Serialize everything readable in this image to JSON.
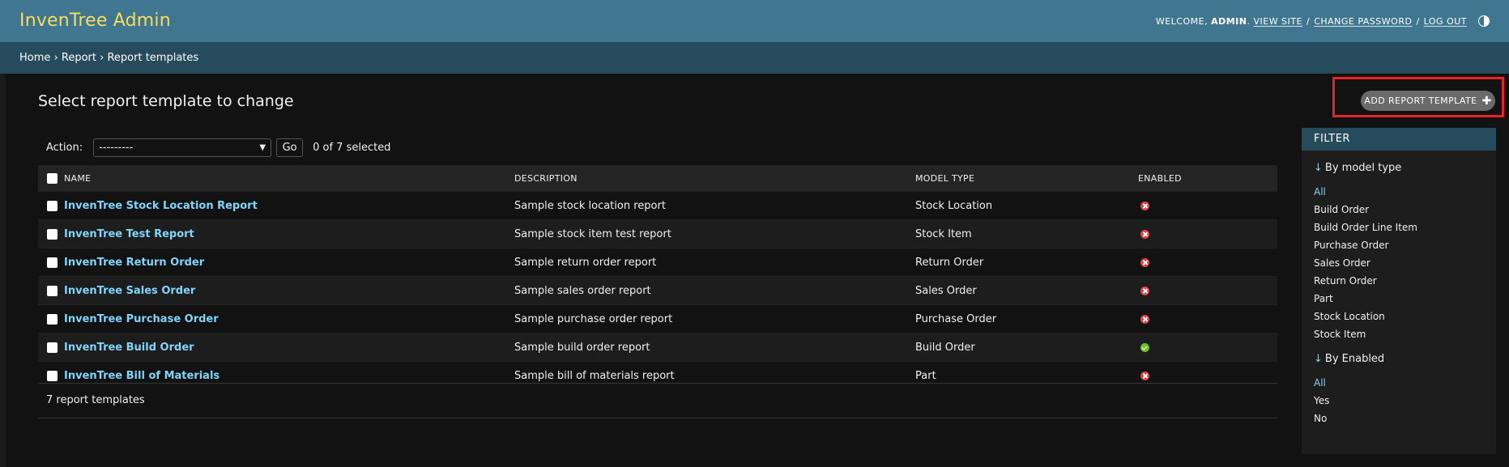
{
  "header": {
    "brand": "InvenTree Admin",
    "welcome": "Welcome,",
    "user": "admin",
    "links": {
      "view_site": "View site",
      "change_password": "Change password",
      "log_out": "Log out"
    },
    "separator": "/"
  },
  "breadcrumbs": {
    "home": "Home",
    "section": "Report",
    "current": "Report templates",
    "sep": "›"
  },
  "page": {
    "title": "Select report template to change",
    "add_button": "ADD REPORT TEMPLATE"
  },
  "actions": {
    "label": "Action:",
    "select_value": "---------",
    "go": "Go",
    "selected": "0 of 7 selected"
  },
  "table": {
    "columns": [
      "NAME",
      "DESCRIPTION",
      "MODEL TYPE",
      "ENABLED"
    ],
    "rows": [
      {
        "name": "InvenTree Stock Location Report",
        "description": "Sample stock location report",
        "model_type": "Stock Location",
        "enabled": false
      },
      {
        "name": "InvenTree Test Report",
        "description": "Sample stock item test report",
        "model_type": "Stock Item",
        "enabled": false
      },
      {
        "name": "InvenTree Return Order",
        "description": "Sample return order report",
        "model_type": "Return Order",
        "enabled": false
      },
      {
        "name": "InvenTree Sales Order",
        "description": "Sample sales order report",
        "model_type": "Sales Order",
        "enabled": false
      },
      {
        "name": "InvenTree Purchase Order",
        "description": "Sample purchase order report",
        "model_type": "Purchase Order",
        "enabled": false
      },
      {
        "name": "InvenTree Build Order",
        "description": "Sample build order report",
        "model_type": "Build Order",
        "enabled": true
      },
      {
        "name": "InvenTree Bill of Materials",
        "description": "Sample bill of materials report",
        "model_type": "Part",
        "enabled": false
      }
    ]
  },
  "paginator": {
    "text": "7 report templates"
  },
  "filter": {
    "title": "FILTER",
    "arrow": "↓",
    "groups": [
      {
        "heading": "By model type",
        "items": [
          "All",
          "Build Order",
          "Build Order Line Item",
          "Purchase Order",
          "Sales Order",
          "Return Order",
          "Part",
          "Stock Location",
          "Stock Item"
        ],
        "selected": 0
      },
      {
        "heading": "By Enabled",
        "items": [
          "All",
          "Yes",
          "No"
        ],
        "selected": 0
      }
    ]
  },
  "colors": {
    "header_bg": "#417690",
    "breadcrumb_bg": "#264b5d",
    "brand": "#f5dd5d",
    "link": "#81d4fa",
    "highlight": "#e8232a"
  }
}
